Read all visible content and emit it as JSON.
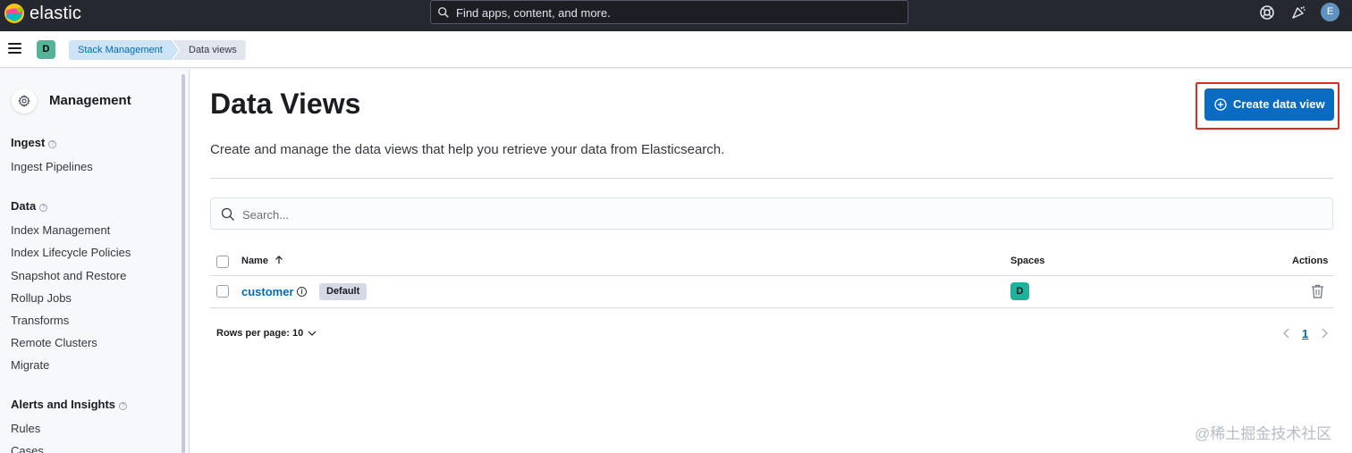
{
  "topbar": {
    "brand": "elastic",
    "search_placeholder": "Find apps, content, and more.",
    "user_initial": "E"
  },
  "header": {
    "space_initial": "D",
    "breadcrumbs": [
      "Stack Management",
      "Data views"
    ]
  },
  "sidebar": {
    "title": "Management",
    "sections": [
      {
        "title": "Ingest",
        "items": [
          "Ingest Pipelines"
        ]
      },
      {
        "title": "Data",
        "items": [
          "Index Management",
          "Index Lifecycle Policies",
          "Snapshot and Restore",
          "Rollup Jobs",
          "Transforms",
          "Remote Clusters",
          "Migrate"
        ]
      },
      {
        "title": "Alerts and Insights",
        "items": [
          "Rules",
          "Cases"
        ]
      }
    ]
  },
  "main": {
    "title": "Data Views",
    "description": "Create and manage the data views that help you retrieve your data from Elasticsearch.",
    "create_button": "Create data view",
    "search_placeholder": "Search...",
    "table": {
      "columns": [
        "Name",
        "Spaces",
        "Actions"
      ],
      "rows": [
        {
          "name": "customer",
          "badge": "Default",
          "space": "D"
        }
      ]
    },
    "pagination": {
      "rows_per_page": "Rows per page: 10",
      "current_page": "1"
    }
  },
  "watermark": "@稀土掘金技术社区",
  "colors": {
    "topbar": "#25282f",
    "primary": "#0a6bc2",
    "link": "#006bb8",
    "space_badge": "#54b399",
    "highlight": "#e02b20"
  }
}
